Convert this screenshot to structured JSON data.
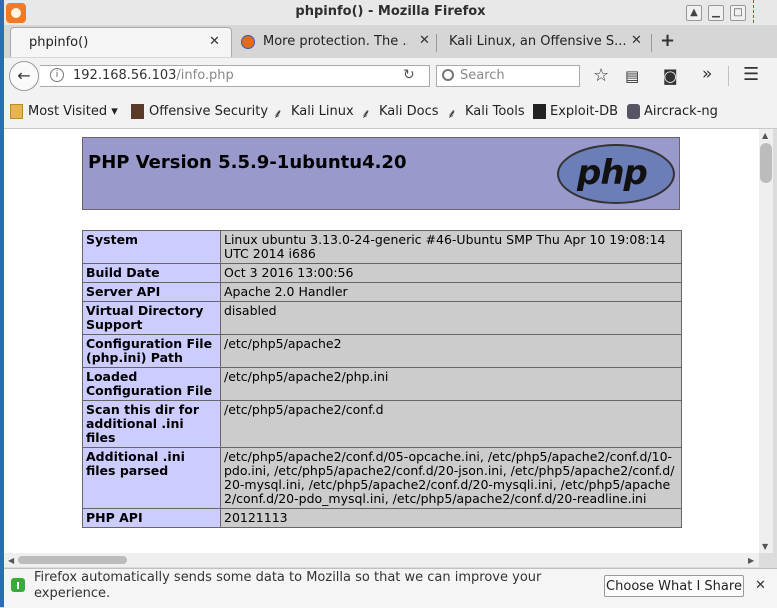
{
  "window": {
    "title": "phpinfo() - Mozilla Firefox"
  },
  "tabs": [
    {
      "label": "phpinfo()",
      "close": "✕"
    },
    {
      "label": "More protection. The ...",
      "close": "✕"
    },
    {
      "label": "Kali Linux, an Offensive S...",
      "close": "✕"
    }
  ],
  "new_tab": "+",
  "nav": {
    "url_host": "192.168.56.103",
    "url_path": "/info.php",
    "search_placeholder": "Search"
  },
  "bookmarks": [
    {
      "label": "Most Visited ▾"
    },
    {
      "label": "Offensive Security"
    },
    {
      "label": "Kali Linux"
    },
    {
      "label": "Kali Docs"
    },
    {
      "label": "Kali Tools"
    },
    {
      "label": "Exploit-DB"
    },
    {
      "label": "Aircrack-ng"
    }
  ],
  "php": {
    "version_title": "PHP Version 5.5.9-1ubuntu4.20",
    "logo_text": "php",
    "rows": [
      {
        "key": "System",
        "value": "Linux ubuntu 3.13.0-24-generic #46-Ubuntu SMP Thu Apr 10 19:08:14 UTC 2014 i686"
      },
      {
        "key": "Build Date",
        "value": "Oct 3 2016 13:00:56"
      },
      {
        "key": "Server API",
        "value": "Apache 2.0 Handler"
      },
      {
        "key": "Virtual Directory Support",
        "value": "disabled"
      },
      {
        "key": "Configuration File (php.ini) Path",
        "value": "/etc/php5/apache2"
      },
      {
        "key": "Loaded Configuration File",
        "value": "/etc/php5/apache2/php.ini"
      },
      {
        "key": "Scan this dir for additional .ini files",
        "value": "/etc/php5/apache2/conf.d"
      },
      {
        "key": "Additional .ini files parsed",
        "value": "/etc/php5/apache2/conf.d/05-opcache.ini, /etc/php5/apache2/conf.d/10-pdo.ini, /etc/php5/apache2/conf.d/20-json.ini, /etc/php5/apache2/conf.d/20-mysql.ini, /etc/php5/apache2/conf.d/20-mysqli.ini, /etc/php5/apache2/conf.d/20-pdo_mysql.ini, /etc/php5/apache2/conf.d/20-readline.ini"
      },
      {
        "key": "PHP API",
        "value": "20121113"
      }
    ]
  },
  "notification": {
    "text": "Firefox automatically sends some data to Mozilla so that we can improve your experience.",
    "button": "Choose What I Share",
    "close": "✕"
  },
  "colors": {
    "php_header_bg": "#9999cc",
    "php_key_bg": "#ccccff",
    "php_value_bg": "#cccccc",
    "desktop_blue": "#2b6cb3"
  }
}
